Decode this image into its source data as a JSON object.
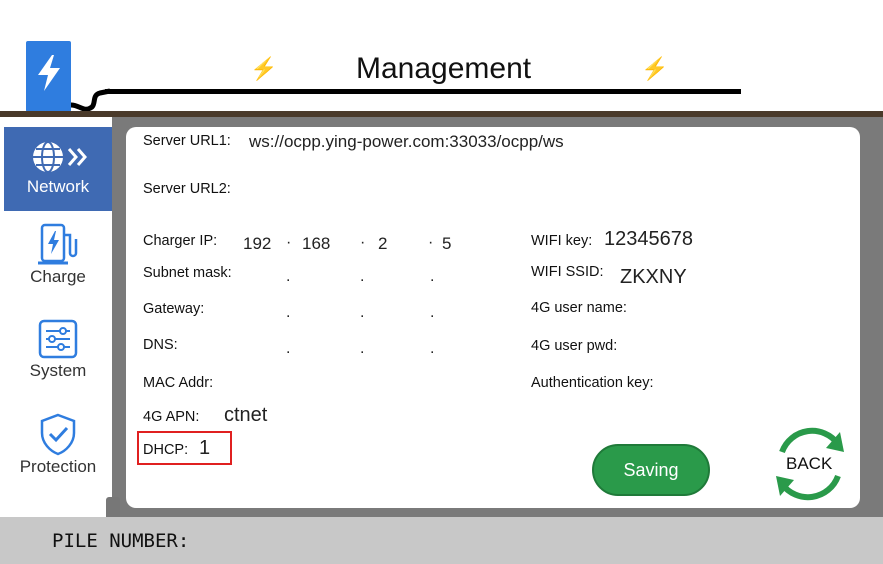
{
  "header": {
    "title": "Management"
  },
  "sidebar": {
    "items": [
      {
        "label": "Network",
        "icon": "globe-icon",
        "active": true
      },
      {
        "label": "Charge",
        "icon": "charger-icon",
        "active": false
      },
      {
        "label": "System",
        "icon": "settings-sliders-icon",
        "active": false
      },
      {
        "label": "Protection",
        "icon": "shield-check-icon",
        "active": false
      }
    ]
  },
  "network": {
    "server_url1_label": "Server URL1:",
    "server_url1_value": "ws://ocpp.ying-power.com:33033/ocpp/ws",
    "server_url2_label": "Server URL2:",
    "server_url2_value": "",
    "charger_ip_label": "Charger IP:",
    "charger_ip": [
      "192",
      "168",
      "2",
      "5"
    ],
    "subnet_mask_label": "Subnet mask:",
    "gateway_label": "Gateway:",
    "dns_label": "DNS:",
    "mac_label": "MAC Addr:",
    "apn_label": "4G APN:",
    "apn_value": "ctnet",
    "dhcp_label": "DHCP:",
    "dhcp_value": "1",
    "wifi_key_label": "WIFI key:",
    "wifi_key_value": "12345678",
    "wifi_ssid_label": "WIFI SSID:",
    "wifi_ssid_value": "ZKXNY",
    "g4_user_label": "4G user name:",
    "g4_pwd_label": "4G user pwd:",
    "auth_key_label": "Authentication key:"
  },
  "buttons": {
    "saving": "Saving",
    "back": "BACK"
  },
  "footer": {
    "pile_number_label": "PILE NUMBER:"
  },
  "colors": {
    "accent_blue": "#2f7ddf",
    "active_tab": "#3f6ab3",
    "save_green": "#2a9a4a",
    "back_green": "#2a9a4a",
    "highlight_red": "#e02020"
  }
}
